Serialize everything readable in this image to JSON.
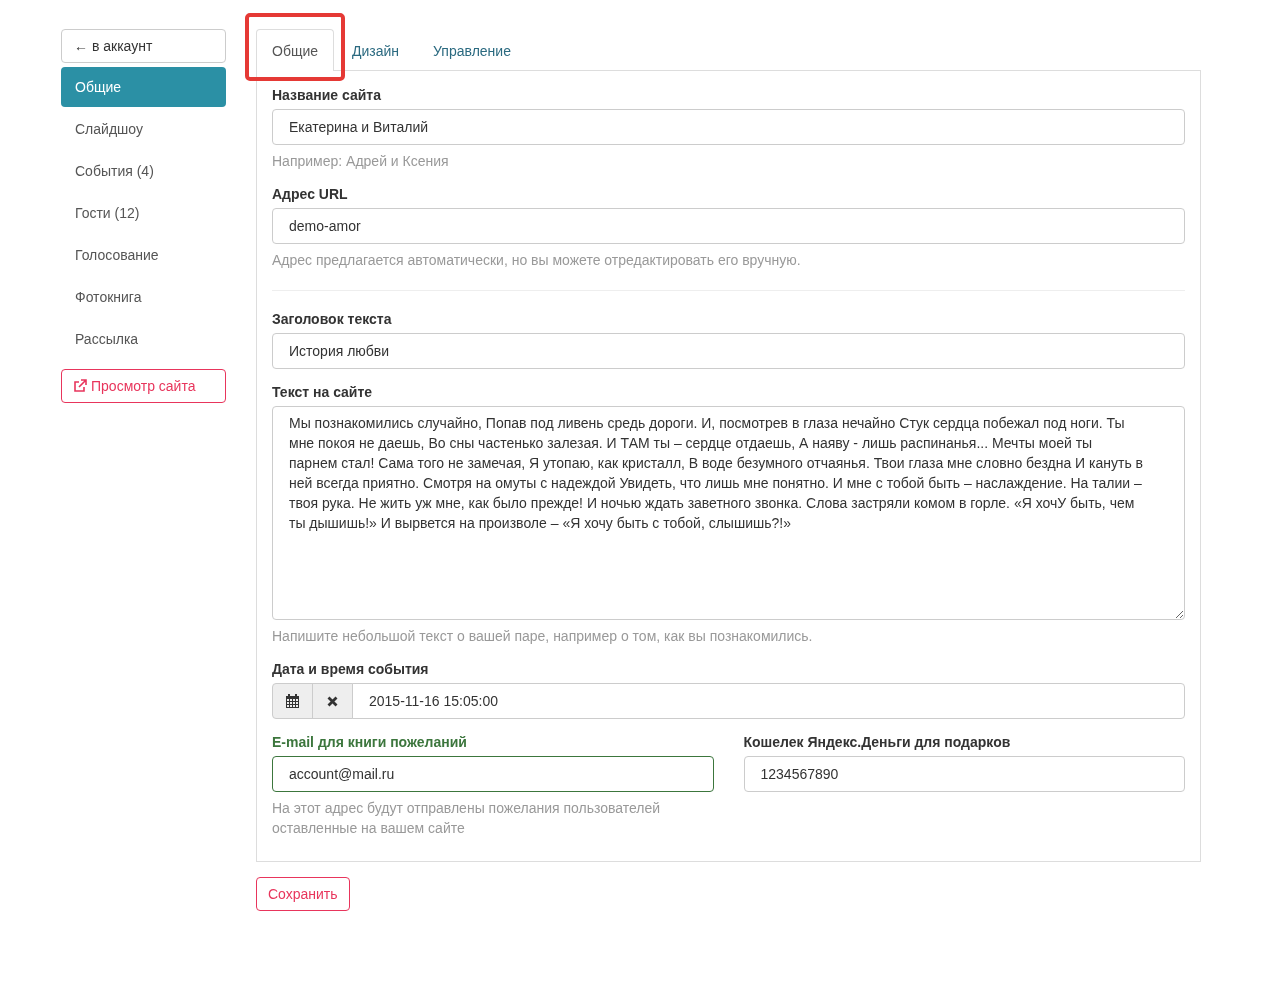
{
  "sidebar": {
    "back_button": {
      "arrow": "←",
      "label": "в аккаунт"
    },
    "items": [
      {
        "label": "Общие",
        "selected": true
      },
      {
        "label": "Слайдшоу",
        "selected": false
      },
      {
        "label": "События (4)",
        "selected": false
      },
      {
        "label": "Гости (12)",
        "selected": false
      },
      {
        "label": "Голосование",
        "selected": false
      },
      {
        "label": "Фотокнига",
        "selected": false
      },
      {
        "label": "Рассылка",
        "selected": false
      }
    ],
    "preview_button": {
      "label": "Просмотр сайта"
    }
  },
  "tabs": [
    {
      "label": "Общие",
      "selected": true,
      "highlighted": true
    },
    {
      "label": "Дизайн",
      "selected": false,
      "highlighted": false
    },
    {
      "label": "Управление",
      "selected": false,
      "highlighted": false
    }
  ],
  "fields": [
    {
      "kind": "text",
      "label": "Название сайта",
      "value": "Екатерина и Виталий",
      "help": "Например: Адрей и Ксения"
    },
    {
      "kind": "text",
      "label": "Адрес URL",
      "value": "demo-amor",
      "help": "Адрес предлагается автоматически, но вы можете отредактировать его вручную."
    },
    {
      "kind": "rule"
    },
    {
      "kind": "text",
      "label": "Заголовок текста",
      "value": "История любви"
    },
    {
      "kind": "textarea",
      "label": "Текст на сайте",
      "value": "Мы познакомились случайно, Попав под ливень средь дороги. И, посмотрев в глаза нечайно Стук сердца побежал под ноги. Ты мне покоя не даешь, Во сны частенько залезая. И ТАМ ты – сердце отдаешь, А наяву - лишь распинанья... Мечты моей ты парнем стал! Сама того не замечая, Я утопаю, как кристалл, В воде безумного отчаянья. Твои глаза мне словно бездна И кануть в ней всегда приятно. Смотря на омуты с надеждой Увидеть, что лишь мне понятно. И мне с тобой быть – наслаждение. На талии – твоя рука. Не жить уж мне, как было прежде! И ночью ждать заветного звонка. Слова застряли комом в горле. «Я хочУ быть, чем ты дышишь!» И вырвется на произволе – «Я хочу быть с тобой, слышишь?!»",
      "help": "Напишите небольшой текст о вашей паре, например о том, как вы познакомились."
    },
    {
      "kind": "datetime",
      "label": "Дата и время события",
      "value": "2015-11-16 15:05:00"
    },
    {
      "kind": "pair",
      "columns": [
        {
          "label": "E-mail для книги пожеланий",
          "value": "account@mail.ru",
          "valid": true,
          "help": "На этот адрес будут отправлены пожелания пользователей оставленные на вашем сайте"
        },
        {
          "label": "Кошелек Яндекс.Деньги для подарков",
          "value": "1234567890",
          "valid": false
        }
      ]
    }
  ],
  "save_button": {
    "label": "Сохранить"
  }
}
